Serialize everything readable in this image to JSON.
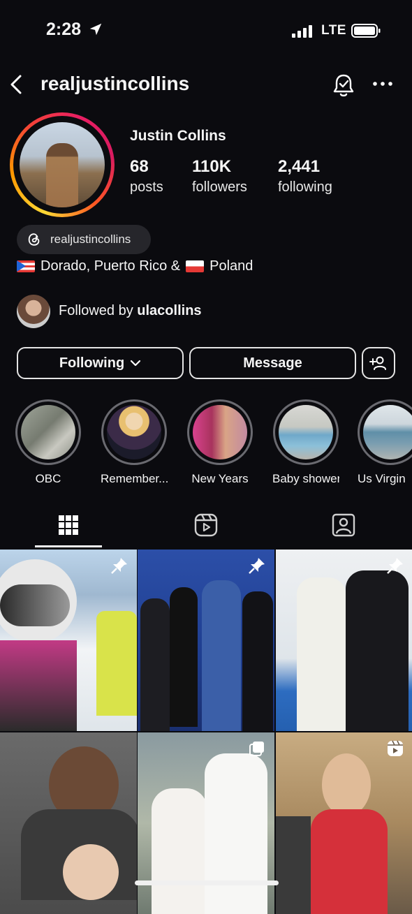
{
  "status_bar": {
    "time": "2:28",
    "network": "LTE"
  },
  "header": {
    "username": "realjustincollins"
  },
  "profile": {
    "full_name": "Justin Collins",
    "stats": [
      {
        "value": "68",
        "label": "posts"
      },
      {
        "value": "110K",
        "label": "followers"
      },
      {
        "value": "2,441",
        "label": "following"
      }
    ],
    "threads_handle": "realjustincollins",
    "location_part1": "Dorado, Puerto Rico &",
    "location_part2": "Poland",
    "followed_by_prefix": "Followed by ",
    "followed_by_user": "ulacollins"
  },
  "buttons": {
    "following": "Following",
    "message": "Message"
  },
  "highlights": [
    {
      "label": "OBC"
    },
    {
      "label": "Remember..."
    },
    {
      "label": "New Years"
    },
    {
      "label": "Baby shower"
    },
    {
      "label": "Us Virgin"
    }
  ],
  "colors": {
    "background": "#0b0b0f",
    "text": "#f5f5f5",
    "chip": "#26262b"
  },
  "icons": {
    "back": "chevron-left-icon",
    "notifications": "bell-check-icon",
    "more": "more-horizontal-icon",
    "threads": "threads-icon",
    "add_user": "add-user-icon",
    "tab_grid": "grid-icon",
    "tab_reels": "reels-icon",
    "tab_tagged": "tagged-icon"
  }
}
